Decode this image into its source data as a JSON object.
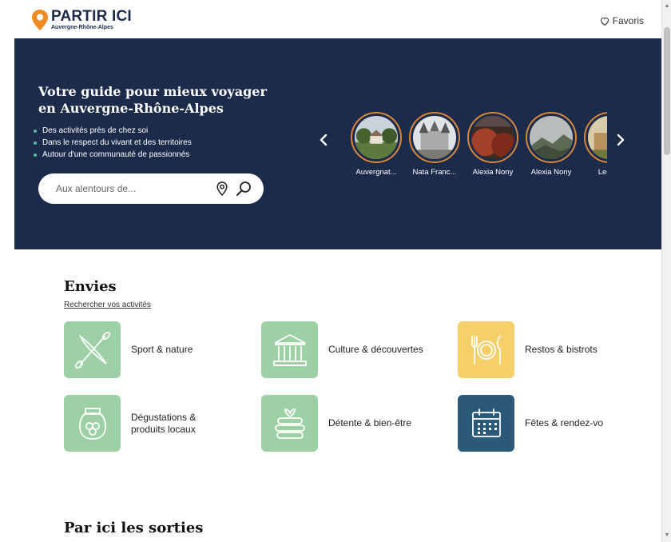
{
  "header": {
    "logo_title": "PARTIR ICI",
    "logo_subtitle": "Auvergne-Rhône-Alpes",
    "favoris_label": "Favoris"
  },
  "hero": {
    "title": "Votre guide pour mieux voyager en Auvergne-Rhône-Alpes",
    "bullets": [
      "Des activités près de chez soi",
      "Dans le respect du vivant et des territoires",
      "Autour d'une communauté de passionnés"
    ],
    "search_placeholder": "Aux alentours de...",
    "carousel": [
      {
        "name": "Auvergnat..."
      },
      {
        "name": "Nata Franc..."
      },
      {
        "name": "Alexia Nony"
      },
      {
        "name": "Alexia Nony"
      },
      {
        "name": "Les pe"
      }
    ]
  },
  "envies": {
    "title": "Envies",
    "link": "Rechercher vos activités",
    "categories": [
      {
        "label": "Sport & nature",
        "color": "#9dd1a5",
        "icon": "kayak-icon"
      },
      {
        "label": "Culture & découvertes",
        "color": "#9dd1a5",
        "icon": "museum-icon"
      },
      {
        "label": "Restos & bistrots",
        "color": "#f4cf6a",
        "icon": "plate-cutlery-icon"
      },
      {
        "label": "Dégustations & produits locaux",
        "label_line1": "Dégustations &",
        "label_line2": "produits locaux",
        "color": "#9dd1a5",
        "icon": "jar-icon"
      },
      {
        "label": "Détente & bien-être",
        "color": "#9dd1a5",
        "icon": "spa-stones-icon"
      },
      {
        "label": "Fêtes & rendez-vo",
        "color": "#2a5a78",
        "icon": "calendar-icon"
      }
    ]
  },
  "sorties": {
    "title": "Par ici les sorties"
  }
}
